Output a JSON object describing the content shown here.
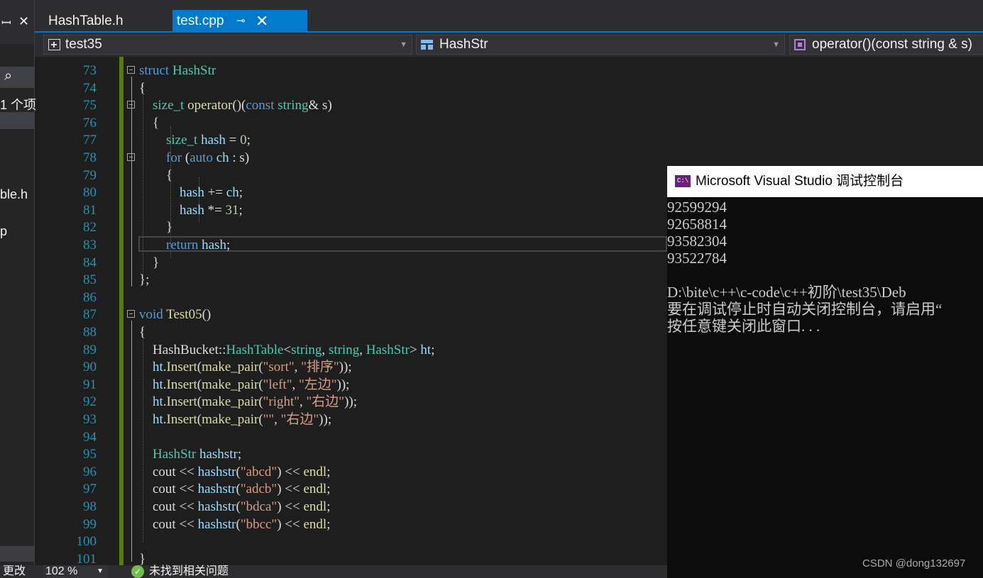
{
  "left_panel": {
    "pin_glyph": "ꟷ",
    "close_glyph": "✕",
    "search_glyph": "⌕",
    "count_text": "1 个项",
    "file1": "ble.h",
    "file2": "p",
    "changes_text": "更改"
  },
  "tabs": [
    {
      "label": "HashTable.h"
    },
    {
      "label": "test.cpp",
      "pin_glyph": "⊸",
      "close_glyph": "✕"
    }
  ],
  "navbar": {
    "project": "test35",
    "scope": "HashStr",
    "member": "operator()(const string & s)"
  },
  "editor": {
    "line_numbers": [
      "73",
      "74",
      "75",
      "76",
      "77",
      "78",
      "79",
      "80",
      "81",
      "82",
      "83",
      "84",
      "85",
      "86",
      "87",
      "88",
      "89",
      "90",
      "91",
      "92",
      "93",
      "94",
      "95",
      "96",
      "97",
      "98",
      "99",
      "100",
      "101"
    ]
  },
  "statusbar": {
    "zoom": "102 %",
    "issues": "未找到相关问题"
  },
  "console": {
    "title": "Microsoft Visual Studio 调试控制台",
    "icon_text": "C:\\",
    "lines": [
      "92599294",
      "92658814",
      "93582304",
      "93522784",
      "",
      "D:\\bite\\c++\\c-code\\c++初阶\\test35\\Deb",
      "要在调试停止时自动关闭控制台，请启用“",
      "按任意键关闭此窗口. . ."
    ],
    "watermark": "CSDN @dong132697"
  },
  "colors": {
    "accent": "#007acc",
    "keyword": "#569cd6",
    "type": "#4ec9b0",
    "string": "#d69d85",
    "number": "#b5cea8",
    "line_number": "#2b91af",
    "gutter_changed": "#587c0c"
  }
}
